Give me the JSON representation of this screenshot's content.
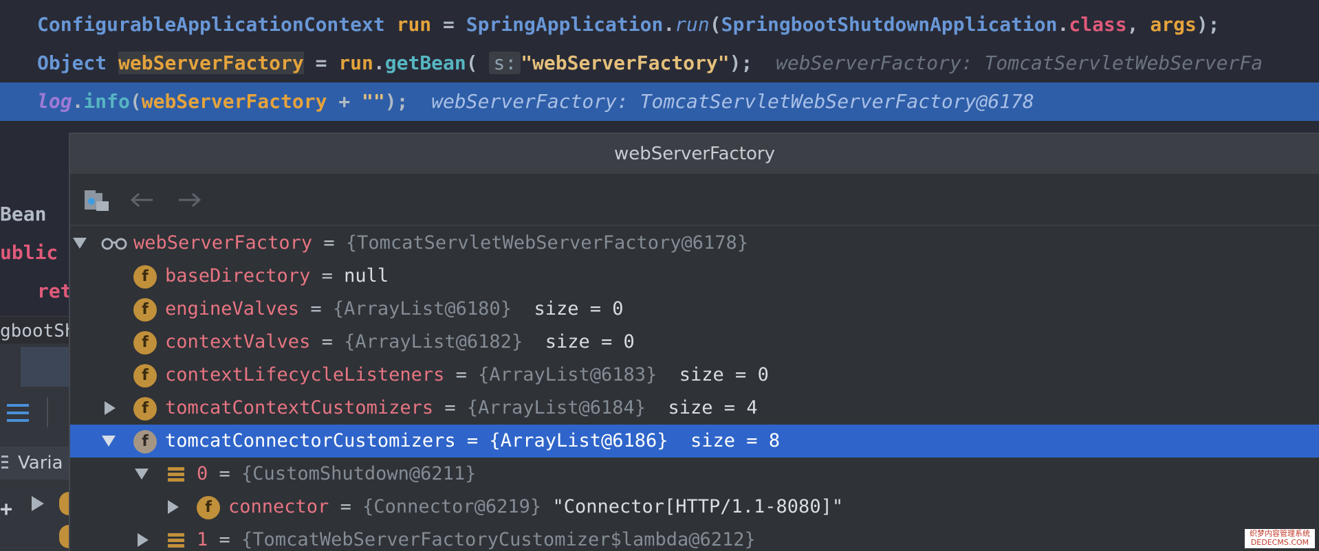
{
  "code": {
    "line1": {
      "type": "ConfigurableApplicationContext",
      "var": "run",
      "eq": " = ",
      "cls": "SpringApplication",
      "dot": ".",
      "method": "run",
      "open": "(",
      "arg_cls": "SpringbootShutdownApplication",
      "dot2": ".",
      "kw": "class",
      "comma": ", ",
      "arg2": "args",
      "close": ");"
    },
    "line2": {
      "type": "Object",
      "var": "webServerFactory",
      "eq": " = ",
      "obj": "run",
      "dot": ".",
      "method": "getBean",
      "open": "( ",
      "param_hint": "s:",
      "str": "\"webServerFactory\"",
      "close": ");",
      "hint": "webServerFactory: TomcatServletWebServerFa"
    },
    "line3": {
      "log": "log",
      "dot": ".",
      "method": "info",
      "open": "(",
      "var": "webServerFactory",
      "plus": " + ",
      "str": "\"\"",
      "close": ");",
      "hint": "webServerFactory: TomcatServletWebServerFactory@6178"
    },
    "side": {
      "bean": "Bean",
      "public": "ublic",
      "ret": "ret",
      "class_frag": "gbootSh",
      "vars": "Varia"
    }
  },
  "popup": {
    "title": "webServerFactory",
    "tree": {
      "root": {
        "name": "webServerFactory",
        "eq": " = ",
        "obj": "{TomcatServletWebServerFactory@6178}"
      },
      "rows": [
        {
          "name": "baseDirectory",
          "eq": " = ",
          "obj": "",
          "val": "null"
        },
        {
          "name": "engineValves",
          "eq": " = ",
          "obj": "{ArrayList@6180}",
          "val": "  size = 0"
        },
        {
          "name": "contextValves",
          "eq": " = ",
          "obj": "{ArrayList@6182}",
          "val": "  size = 0"
        },
        {
          "name": "contextLifecycleListeners",
          "eq": " = ",
          "obj": "{ArrayList@6183}",
          "val": "  size = 0"
        },
        {
          "name": "tomcatContextCustomizers",
          "eq": " = ",
          "obj": "{ArrayList@6184}",
          "val": "  size = 4"
        },
        {
          "name": "tomcatConnectorCustomizers",
          "eq": " = ",
          "obj": "{ArrayList@6186}",
          "val": "  size = 8"
        }
      ],
      "child0": {
        "name": "0",
        "eq": " = ",
        "obj": "{CustomShutdown@6211}"
      },
      "connector": {
        "name": "connector",
        "eq": " = ",
        "obj": "{Connector@6219}",
        "val": " \"Connector[HTTP/1.1-8080]\""
      },
      "child1": {
        "name": "1",
        "eq": " = ",
        "obj": "{TomcatWebServerFactoryCustomizer$lambda@6212}"
      }
    }
  },
  "watermark": {
    "line1": "织梦内容管理系统",
    "line2": "DEDECMS.COM"
  }
}
